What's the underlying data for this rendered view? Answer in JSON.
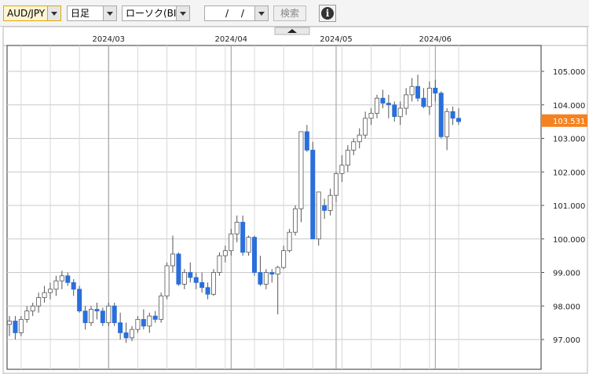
{
  "toolbar": {
    "pair": "AUD/JPY",
    "period": "日足",
    "chart_type": "ローソク(BID)",
    "date": "/ /",
    "search_label": "検索",
    "info_icon": "i"
  },
  "current_price": "103.531",
  "colors": {
    "up": "#ffffff",
    "down": "#2a6fdb",
    "wick": "#555555",
    "price_tag": "#f58220",
    "grid": "#c9c9c9"
  },
  "chart_data": {
    "type": "candlestick",
    "title": "",
    "x_labels": [
      "2024/03",
      "2024/04",
      "2024/05",
      "2024/06"
    ],
    "ylim": [
      96.8,
      105.5
    ],
    "y_ticks": [
      "105.000",
      "104.000",
      "103.000",
      "102.000",
      "101.000",
      "100.000",
      "99.000",
      "98.000",
      "97.000"
    ],
    "candles": [
      [
        97.45,
        97.7,
        97.1,
        97.55
      ],
      [
        97.55,
        97.7,
        97.0,
        97.2
      ],
      [
        97.2,
        97.7,
        97.1,
        97.6
      ],
      [
        97.6,
        98.0,
        97.5,
        97.85
      ],
      [
        97.85,
        98.1,
        97.7,
        98.0
      ],
      [
        98.0,
        98.4,
        97.8,
        98.25
      ],
      [
        98.25,
        98.6,
        98.1,
        98.4
      ],
      [
        98.4,
        98.7,
        98.2,
        98.5
      ],
      [
        98.5,
        98.9,
        98.3,
        98.75
      ],
      [
        98.75,
        99.05,
        98.5,
        98.9
      ],
      [
        98.9,
        99.0,
        98.6,
        98.7
      ],
      [
        98.7,
        98.8,
        98.3,
        98.5
      ],
      [
        98.5,
        98.6,
        97.8,
        97.85
      ],
      [
        97.85,
        98.0,
        97.3,
        97.5
      ],
      [
        97.5,
        98.0,
        97.4,
        97.9
      ],
      [
        97.9,
        98.1,
        97.6,
        97.85
      ],
      [
        97.85,
        97.95,
        97.4,
        97.5
      ],
      [
        97.5,
        98.1,
        97.4,
        98.0
      ],
      [
        98.0,
        98.1,
        97.4,
        97.5
      ],
      [
        97.5,
        97.8,
        97.0,
        97.2
      ],
      [
        97.2,
        97.5,
        96.9,
        97.05
      ],
      [
        97.05,
        97.4,
        96.95,
        97.3
      ],
      [
        97.3,
        97.7,
        97.2,
        97.6
      ],
      [
        97.6,
        97.9,
        97.3,
        97.4
      ],
      [
        97.4,
        97.8,
        97.2,
        97.7
      ],
      [
        97.7,
        97.85,
        97.5,
        97.6
      ],
      [
        97.6,
        98.4,
        97.5,
        98.3
      ],
      [
        98.3,
        99.3,
        98.2,
        99.2
      ],
      [
        99.2,
        100.1,
        99.0,
        99.55
      ],
      [
        99.55,
        99.6,
        98.6,
        98.65
      ],
      [
        98.65,
        99.1,
        98.5,
        99.0
      ],
      [
        99.0,
        99.3,
        98.7,
        98.85
      ],
      [
        98.85,
        99.0,
        98.5,
        98.7
      ],
      [
        98.7,
        99.0,
        98.4,
        98.55
      ],
      [
        98.55,
        98.7,
        98.2,
        98.35
      ],
      [
        98.35,
        99.1,
        98.3,
        99.0
      ],
      [
        99.0,
        99.6,
        98.9,
        99.5
      ],
      [
        99.5,
        99.8,
        99.3,
        99.65
      ],
      [
        99.65,
        100.3,
        99.5,
        100.15
      ],
      [
        100.15,
        100.7,
        99.9,
        100.5
      ],
      [
        100.5,
        100.7,
        99.5,
        99.6
      ],
      [
        99.6,
        100.1,
        99.5,
        100.05
      ],
      [
        100.05,
        100.1,
        98.9,
        99.0
      ],
      [
        99.0,
        99.5,
        98.6,
        98.65
      ],
      [
        98.65,
        99.1,
        98.5,
        99.0
      ],
      [
        99.0,
        99.1,
        98.7,
        98.95
      ],
      [
        98.95,
        99.2,
        97.75,
        99.15
      ],
      [
        99.15,
        99.8,
        99.1,
        99.65
      ],
      [
        99.65,
        100.3,
        99.6,
        100.2
      ],
      [
        100.2,
        101.0,
        100.1,
        100.9
      ],
      [
        100.9,
        103.2,
        100.5,
        103.2
      ],
      [
        103.2,
        103.4,
        102.6,
        102.65
      ],
      [
        102.65,
        102.9,
        100.2,
        100.0
      ],
      [
        100.0,
        101.4,
        99.8,
        101.4
      ],
      [
        101.0,
        101.2,
        100.6,
        100.85
      ],
      [
        100.85,
        101.5,
        100.7,
        101.3
      ],
      [
        101.3,
        102.0,
        101.1,
        101.95
      ],
      [
        101.95,
        102.5,
        101.7,
        102.2
      ],
      [
        102.2,
        102.8,
        102.0,
        102.65
      ],
      [
        102.65,
        103.0,
        102.5,
        102.9
      ],
      [
        102.9,
        103.3,
        102.7,
        103.1
      ],
      [
        103.1,
        103.8,
        103.0,
        103.6
      ],
      [
        103.6,
        103.9,
        103.4,
        103.75
      ],
      [
        103.75,
        104.3,
        103.6,
        104.2
      ],
      [
        104.2,
        104.45,
        103.9,
        104.05
      ],
      [
        104.05,
        104.3,
        103.6,
        104.0
      ],
      [
        104.0,
        104.1,
        103.5,
        103.65
      ],
      [
        103.65,
        104.1,
        103.4,
        103.9
      ],
      [
        103.9,
        104.5,
        103.7,
        104.3
      ],
      [
        104.3,
        104.8,
        104.1,
        104.55
      ],
      [
        104.55,
        104.9,
        104.1,
        104.2
      ],
      [
        104.2,
        104.5,
        103.9,
        103.95
      ],
      [
        103.95,
        104.7,
        103.7,
        104.5
      ],
      [
        104.5,
        104.75,
        104.1,
        104.35
      ],
      [
        104.35,
        104.4,
        103.0,
        103.05
      ],
      [
        103.05,
        103.9,
        102.65,
        103.8
      ],
      [
        103.8,
        103.95,
        103.4,
        103.6
      ],
      [
        103.6,
        103.9,
        103.4,
        103.5
      ]
    ]
  }
}
